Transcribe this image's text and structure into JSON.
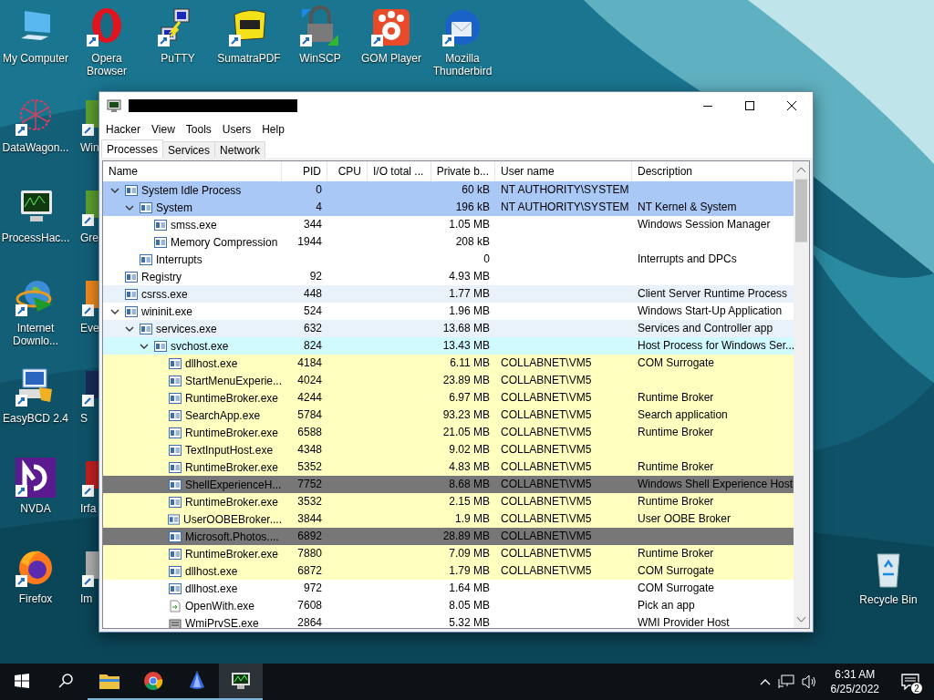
{
  "desktop": {
    "top_row": [
      {
        "label": "My Computer",
        "kind": "computer",
        "shortcut": false
      },
      {
        "label": "Opera Browser",
        "kind": "opera",
        "shortcut": true
      },
      {
        "label": "PuTTY",
        "kind": "putty",
        "shortcut": true
      },
      {
        "label": "SumatraPDF",
        "kind": "pdf",
        "shortcut": true
      },
      {
        "label": "WinSCP",
        "kind": "winscp",
        "shortcut": true
      },
      {
        "label": "GOM Player",
        "kind": "gom",
        "shortcut": true
      },
      {
        "label": "Mozilla Thunderbird",
        "kind": "thunderbird",
        "shortcut": true
      }
    ],
    "left_column": [
      {
        "label": "DataWagon...",
        "kind": "datawagon",
        "shortcut": true
      },
      {
        "label": "ProcessHac...",
        "kind": "processhacker",
        "shortcut": false
      },
      {
        "label": "Internet Downlo...",
        "kind": "idm",
        "shortcut": true
      },
      {
        "label": "EasyBCD 2.4",
        "kind": "easybcd",
        "shortcut": true
      },
      {
        "label": "NVDA",
        "kind": "nvda",
        "shortcut": true
      },
      {
        "label": "Firefox",
        "kind": "firefox",
        "shortcut": true
      }
    ],
    "partly_hidden_column": [
      {
        "label": "Win",
        "kind": "green"
      },
      {
        "label": "Gre",
        "kind": "green"
      },
      {
        "label": "Eve",
        "kind": "orange"
      },
      {
        "label": "S",
        "kind": "navy"
      },
      {
        "label": "Irfa",
        "kind": "red"
      },
      {
        "label": "Im",
        "kind": "gray"
      }
    ],
    "recycle_bin": {
      "label": "Recycle Bin"
    }
  },
  "window": {
    "menu": [
      "Hacker",
      "View",
      "Tools",
      "Users",
      "Help"
    ],
    "tabs": [
      {
        "label": "Processes",
        "selected": true
      },
      {
        "label": "Services",
        "selected": false
      },
      {
        "label": "Network",
        "selected": false
      }
    ],
    "table": {
      "columns": [
        "Name",
        "PID",
        "CPU",
        "I/O total ...",
        "Private b...",
        "User name",
        "Description"
      ],
      "rows": [
        {
          "name": "System Idle Process",
          "pid": "0",
          "private_bytes": "60 kB",
          "user_name": "NT AUTHORITY\\SYSTEM",
          "color": "#aac8f5",
          "expanded": true,
          "children": [
            {
              "name": "System",
              "pid": "4",
              "private_bytes": "196 kB",
              "user_name": "NT AUTHORITY\\SYSTEM",
              "description": "NT Kernel & System",
              "color": "#aac8f5",
              "expanded": true,
              "children": [
                {
                  "name": "smss.exe",
                  "pid": "344",
                  "private_bytes": "1.05 MB",
                  "description": "Windows Session Manager",
                  "color": "#ffffff"
                },
                {
                  "name": "Memory Compression",
                  "pid": "1944",
                  "private_bytes": "208 kB",
                  "color": "#ffffff"
                }
              ]
            },
            {
              "name": "Interrupts",
              "private_bytes": "0",
              "description": "Interrupts and DPCs",
              "color": "#ffffff"
            }
          ]
        },
        {
          "name": "Registry",
          "pid": "92",
          "private_bytes": "4.93 MB",
          "color": "#ffffff"
        },
        {
          "name": "csrss.exe",
          "pid": "448",
          "private_bytes": "1.77 MB",
          "description": "Client Server Runtime Process",
          "color": "#e9f2fb"
        },
        {
          "name": "wininit.exe",
          "pid": "524",
          "private_bytes": "1.96 MB",
          "description": "Windows Start-Up Application",
          "color": "#ffffff",
          "expanded": true,
          "children": [
            {
              "name": "services.exe",
              "pid": "632",
              "private_bytes": "13.68 MB",
              "description": "Services and Controller app",
              "color": "#e9f2fb",
              "expanded": true,
              "children": [
                {
                  "name": "svchost.exe",
                  "pid": "824",
                  "private_bytes": "13.43 MB",
                  "description": "Host Process for Windows Ser...",
                  "color": "#d0faff",
                  "expanded": true,
                  "children": [
                    {
                      "name": "dllhost.exe",
                      "pid": "4184",
                      "private_bytes": "6.11 MB",
                      "user_name": "COLLABNET\\VM5",
                      "description": "COM Surrogate",
                      "color": "#ffffc0"
                    },
                    {
                      "name": "StartMenuExperie...",
                      "pid": "4024",
                      "private_bytes": "23.89 MB",
                      "user_name": "COLLABNET\\VM5",
                      "color": "#ffffc0"
                    },
                    {
                      "name": "RuntimeBroker.exe",
                      "pid": "4244",
                      "private_bytes": "6.97 MB",
                      "user_name": "COLLABNET\\VM5",
                      "description": "Runtime Broker",
                      "color": "#ffffc0"
                    },
                    {
                      "name": "SearchApp.exe",
                      "pid": "5784",
                      "private_bytes": "93.23 MB",
                      "user_name": "COLLABNET\\VM5",
                      "description": "Search application",
                      "color": "#ffffc0"
                    },
                    {
                      "name": "RuntimeBroker.exe",
                      "pid": "6588",
                      "private_bytes": "21.05 MB",
                      "user_name": "COLLABNET\\VM5",
                      "description": "Runtime Broker",
                      "color": "#ffffc0"
                    },
                    {
                      "name": "TextInputHost.exe",
                      "pid": "4348",
                      "private_bytes": "9.02 MB",
                      "user_name": "COLLABNET\\VM5",
                      "color": "#ffffc0"
                    },
                    {
                      "name": "RuntimeBroker.exe",
                      "pid": "5352",
                      "private_bytes": "4.83 MB",
                      "user_name": "COLLABNET\\VM5",
                      "description": "Runtime Broker",
                      "color": "#ffffc0"
                    },
                    {
                      "name": "ShellExperienceH...",
                      "pid": "7752",
                      "private_bytes": "8.68 MB",
                      "user_name": "COLLABNET\\VM5",
                      "description": "Windows Shell Experience Host",
                      "color": "#777777"
                    },
                    {
                      "name": "RuntimeBroker.exe",
                      "pid": "3532",
                      "private_bytes": "2.15 MB",
                      "user_name": "COLLABNET\\VM5",
                      "description": "Runtime Broker",
                      "color": "#ffffc0"
                    },
                    {
                      "name": "UserOOBEBroker....",
                      "pid": "3844",
                      "private_bytes": "1.9 MB",
                      "user_name": "COLLABNET\\VM5",
                      "description": "User OOBE Broker",
                      "color": "#ffffc0"
                    },
                    {
                      "name": "Microsoft.Photos....",
                      "pid": "6892",
                      "private_bytes": "28.89 MB",
                      "user_name": "COLLABNET\\VM5",
                      "color": "#777777"
                    },
                    {
                      "name": "RuntimeBroker.exe",
                      "pid": "7880",
                      "private_bytes": "7.09 MB",
                      "user_name": "COLLABNET\\VM5",
                      "description": "Runtime Broker",
                      "color": "#ffffc0"
                    },
                    {
                      "name": "dllhost.exe",
                      "pid": "6872",
                      "private_bytes": "1.79 MB",
                      "user_name": "COLLABNET\\VM5",
                      "description": "COM Surrogate",
                      "color": "#ffffc0"
                    },
                    {
                      "name": "dllhost.exe",
                      "pid": "972",
                      "private_bytes": "1.64 MB",
                      "description": "COM Surrogate",
                      "color": "#ffffff"
                    },
                    {
                      "name": "OpenWith.exe",
                      "pid": "7608",
                      "private_bytes": "8.05 MB",
                      "description": "Pick an app",
                      "color": "#ffffff",
                      "kind": "launcher"
                    },
                    {
                      "name": "WmiPrvSE.exe",
                      "pid": "2864",
                      "private_bytes": "5.32 MB",
                      "description": "WMI Provider Host",
                      "color": "#ffffff",
                      "kind": "provider"
                    }
                  ]
                }
              ]
            }
          ]
        }
      ]
    }
  },
  "taskbar": {
    "apps": [
      {
        "kind": "folder",
        "running": true,
        "active": false
      },
      {
        "kind": "chrome",
        "running": true,
        "active": false
      },
      {
        "kind": "bluefin",
        "running": true,
        "active": false
      },
      {
        "kind": "processhacker",
        "running": true,
        "active": true
      }
    ],
    "clock": {
      "time": "6:31 AM",
      "date": "6/25/2022"
    },
    "notifications": "2"
  }
}
